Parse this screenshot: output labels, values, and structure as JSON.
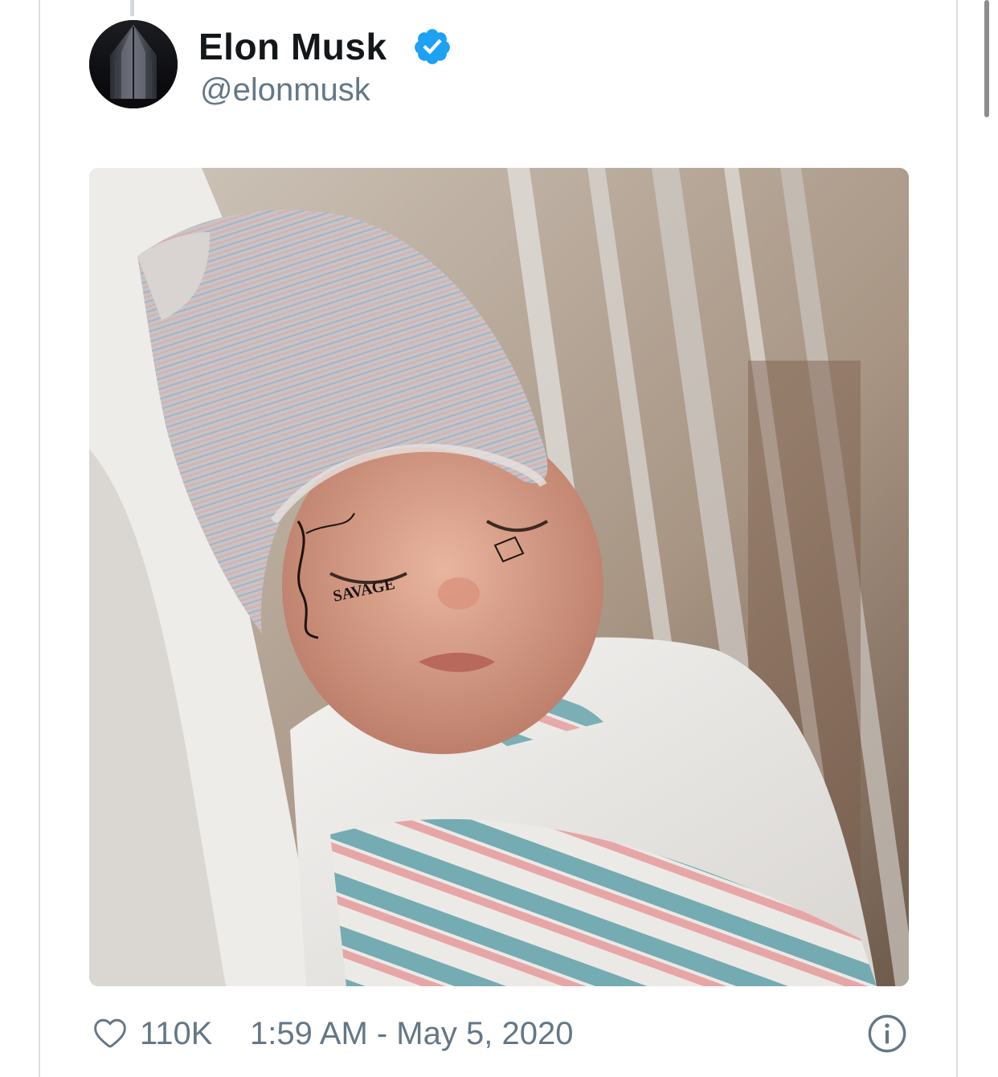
{
  "tweet": {
    "author": {
      "name": "Elon Musk",
      "handle": "@elonmusk",
      "verified": true,
      "avatar_icon": "avatar-image"
    },
    "media": {
      "description_icon": "tweet-photo",
      "tattoo_text": "SAVAGE"
    },
    "footer": {
      "like_icon": "heart-icon",
      "like_count": "110K",
      "timestamp": "1:59 AM - May 5, 2020",
      "info_icon": "info-icon"
    }
  },
  "colors": {
    "text_primary": "#14171a",
    "text_secondary": "#657786",
    "verified_blue": "#1da1f2",
    "border": "#d9dde2"
  }
}
